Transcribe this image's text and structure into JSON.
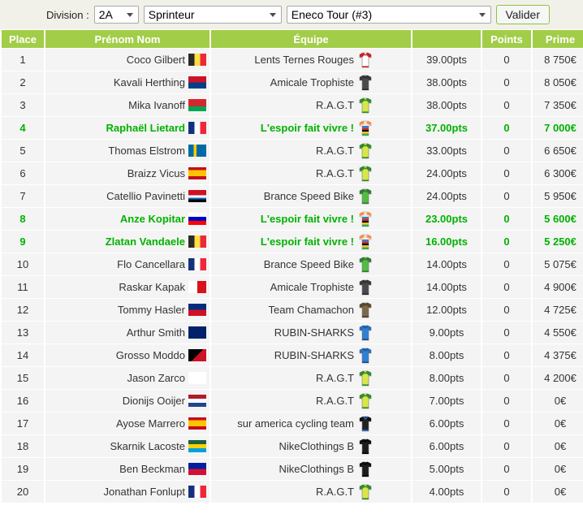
{
  "filters": {
    "division_label": "Division :",
    "division_value": "2A",
    "role_value": "Sprinteur",
    "race_value": "Eneco Tour (#3)",
    "submit_label": "Valider"
  },
  "table": {
    "headers": {
      "place": "Place",
      "name": "Prénom Nom",
      "team": "Équipe",
      "pts": "",
      "points": "Points",
      "prime": "Prime"
    },
    "rows": [
      {
        "place": "1",
        "name": "Coco Gilbert",
        "flag": "belgium",
        "team": "Lents Ternes Rouges",
        "jersey": "white-red",
        "pts": "39.00pts",
        "points": "0",
        "prime": "8 750€",
        "highlight": false
      },
      {
        "place": "2",
        "name": "Kavali Herthing",
        "flag": "kiribati",
        "team": "Amicale Trophiste",
        "jersey": "dark-grey",
        "pts": "38.00pts",
        "points": "0",
        "prime": "8 050€",
        "highlight": false
      },
      {
        "place": "3",
        "name": "Mika Ivanoff",
        "flag": "belarus",
        "team": "R.A.G.T",
        "jersey": "green-yellow",
        "pts": "38.00pts",
        "points": "0",
        "prime": "7 350€",
        "highlight": false
      },
      {
        "place": "4",
        "name": "Raphaël Lietard",
        "flag": "france",
        "team": "L'espoir fait vivre !",
        "jersey": "rainbow",
        "pts": "37.00pts",
        "points": "0",
        "prime": "7 000€",
        "highlight": true
      },
      {
        "place": "5",
        "name": "Thomas Elstrom",
        "flag": "sweden",
        "team": "R.A.G.T",
        "jersey": "green-yellow",
        "pts": "33.00pts",
        "points": "0",
        "prime": "6 650€",
        "highlight": false
      },
      {
        "place": "6",
        "name": "Braizz Vicus",
        "flag": "spain",
        "team": "R.A.G.T",
        "jersey": "green-yellow",
        "pts": "24.00pts",
        "points": "0",
        "prime": "6 300€",
        "highlight": false
      },
      {
        "place": "7",
        "name": "Catellio Pavinetti",
        "flag": "antigua",
        "team": "Brance Speed Bike",
        "jersey": "green",
        "pts": "24.00pts",
        "points": "0",
        "prime": "5 950€",
        "highlight": false
      },
      {
        "place": "8",
        "name": "Anze Kopitar",
        "flag": "slovenia",
        "team": "L'espoir fait vivre !",
        "jersey": "rainbow",
        "pts": "23.00pts",
        "points": "0",
        "prime": "5 600€",
        "highlight": true
      },
      {
        "place": "9",
        "name": "Zlatan Vandaele",
        "flag": "belgium",
        "team": "L'espoir fait vivre !",
        "jersey": "rainbow",
        "pts": "16.00pts",
        "points": "0",
        "prime": "5 250€",
        "highlight": true
      },
      {
        "place": "10",
        "name": "Flo Cancellara",
        "flag": "france",
        "team": "Brance Speed Bike",
        "jersey": "green",
        "pts": "14.00pts",
        "points": "0",
        "prime": "5 075€",
        "highlight": false
      },
      {
        "place": "11",
        "name": "Raskar Kapak",
        "flag": "panama",
        "team": "Amicale Trophiste",
        "jersey": "dark-grey",
        "pts": "14.00pts",
        "points": "0",
        "prime": "4 900€",
        "highlight": false
      },
      {
        "place": "12",
        "name": "Tommy Hasler",
        "flag": "liechtenstein",
        "team": "Team Chamachon",
        "jersey": "brown",
        "pts": "12.00pts",
        "points": "0",
        "prime": "4 725€",
        "highlight": false
      },
      {
        "place": "13",
        "name": "Arthur Smith",
        "flag": "unitedkingdom",
        "team": "RUBIN-SHARKS",
        "jersey": "blue",
        "pts": "9.00pts",
        "points": "0",
        "prime": "4 550€",
        "highlight": false
      },
      {
        "place": "14",
        "name": "Grosso Moddo",
        "flag": "papuanewguinea",
        "team": "RUBIN-SHARKS",
        "jersey": "blue",
        "pts": "8.00pts",
        "points": "0",
        "prime": "4 375€",
        "highlight": false
      },
      {
        "place": "15",
        "name": "Jason Zarco",
        "flag": "cyprus",
        "team": "R.A.G.T",
        "jersey": "green-yellow",
        "pts": "8.00pts",
        "points": "0",
        "prime": "4 200€",
        "highlight": false
      },
      {
        "place": "16",
        "name": "Dionijs Ooijer",
        "flag": "netherlands",
        "team": "R.A.G.T",
        "jersey": "green-yellow",
        "pts": "7.00pts",
        "points": "0",
        "prime": "0€",
        "highlight": false
      },
      {
        "place": "17",
        "name": "Ayose Marrero",
        "flag": "spain",
        "team": "sur america cycling team",
        "jersey": "black-blue",
        "pts": "6.00pts",
        "points": "0",
        "prime": "0€",
        "highlight": false
      },
      {
        "place": "18",
        "name": "Skarnik Lacoste",
        "flag": "rwanda",
        "team": "NikeClothings B",
        "jersey": "black",
        "pts": "6.00pts",
        "points": "0",
        "prime": "0€",
        "highlight": false
      },
      {
        "place": "19",
        "name": "Ben Beckman",
        "flag": "haiti",
        "team": "NikeClothings B",
        "jersey": "black",
        "pts": "5.00pts",
        "points": "0",
        "prime": "0€",
        "highlight": false
      },
      {
        "place": "20",
        "name": "Jonathan Fonlupt",
        "flag": "france",
        "team": "R.A.G.T",
        "jersey": "green-yellow",
        "pts": "4.00pts",
        "points": "0",
        "prime": "0€",
        "highlight": false
      }
    ]
  },
  "colors": {
    "header_green": "#a2cd48",
    "row_bg": "#f4f4f4",
    "normal_text_green": "#b8d64a",
    "highlight_text_green": "#00b200",
    "filterbar_bg": "#f2f1e9"
  }
}
